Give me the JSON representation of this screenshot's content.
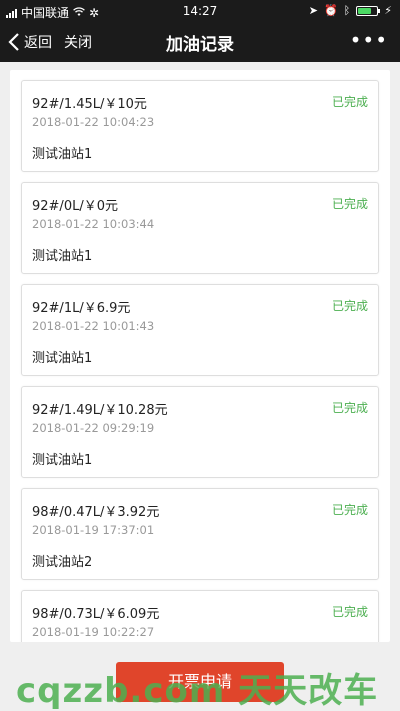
{
  "status_bar": {
    "carrier": "中国联通",
    "time": "14:27"
  },
  "nav": {
    "back_label": "返回",
    "close_label": "关闭",
    "title": "加油记录",
    "more_label": "•••"
  },
  "records": [
    {
      "summary": "92#/1.45L/￥10元",
      "time": "2018-01-22 10:04:23",
      "station": "测试油站1",
      "status": "已完成"
    },
    {
      "summary": "92#/0L/￥0元",
      "time": "2018-01-22 10:03:44",
      "station": "测试油站1",
      "status": "已完成"
    },
    {
      "summary": "92#/1L/￥6.9元",
      "time": "2018-01-22 10:01:43",
      "station": "测试油站1",
      "status": "已完成"
    },
    {
      "summary": "92#/1.49L/￥10.28元",
      "time": "2018-01-22 09:29:19",
      "station": "测试油站1",
      "status": "已完成"
    },
    {
      "summary": "98#/0.47L/￥3.92元",
      "time": "2018-01-19 17:37:01",
      "station": "测试油站2",
      "status": "已完成"
    },
    {
      "summary": "98#/0.73L/￥6.09元",
      "time": "2018-01-19 10:22:27",
      "station": "",
      "status": "已完成"
    }
  ],
  "bottom": {
    "invoice_button": "开票申请"
  },
  "watermark": "cqzzb.com 天天改车",
  "colors": {
    "status_complete": "#4caf50",
    "primary_button": "#e0452b",
    "nav_background": "#1b1b1b"
  }
}
